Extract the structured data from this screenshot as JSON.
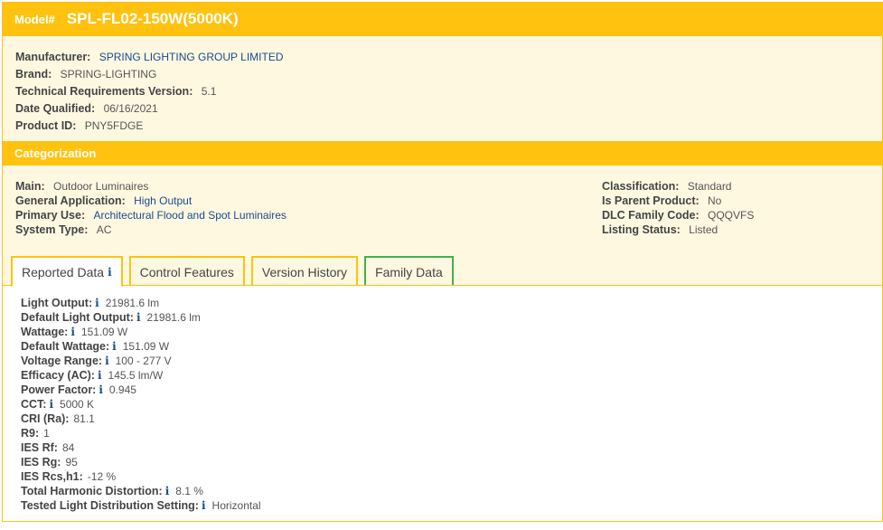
{
  "model": {
    "label": "Model#",
    "value": "SPL-FL02-150W(5000K)"
  },
  "info": [
    {
      "label": "Manufacturer:",
      "value": "SPRING LIGHTING GROUP LIMITED",
      "link": true
    },
    {
      "label": "Brand:",
      "value": "SPRING-LIGHTING",
      "link": false
    },
    {
      "label": "Technical Requirements Version:",
      "value": "5.1",
      "link": false
    },
    {
      "label": "Date Qualified:",
      "value": "06/16/2021",
      "link": false
    },
    {
      "label": "Product ID:",
      "value": "PNY5FDGE",
      "link": false
    }
  ],
  "categorization": {
    "title": "Categorization",
    "left": [
      {
        "label": "Main:",
        "value": "Outdoor Luminaires",
        "link": false
      },
      {
        "label": "General Application:",
        "value": "High Output",
        "link": true
      },
      {
        "label": "Primary Use:",
        "value": "Architectural Flood and Spot Luminaires",
        "link": true
      },
      {
        "label": "System Type:",
        "value": "AC",
        "link": false
      }
    ],
    "right": [
      {
        "label": "Classification:",
        "value": "Standard"
      },
      {
        "label": "Is Parent Product:",
        "value": "No"
      },
      {
        "label": "DLC Family Code:",
        "value": "QQQVFS"
      },
      {
        "label": "Listing Status:",
        "value": "Listed"
      }
    ]
  },
  "tabs": [
    {
      "label": "Reported Data",
      "active": true,
      "info": true
    },
    {
      "label": "Control Features",
      "active": false,
      "info": false
    },
    {
      "label": "Version History",
      "active": false,
      "info": false
    },
    {
      "label": "Family Data",
      "active": false,
      "info": false
    }
  ],
  "reported_data": [
    {
      "label": "Light Output:",
      "value": "21981.6 lm",
      "info": true
    },
    {
      "label": "Default Light Output:",
      "value": "21981.6 lm",
      "info": true
    },
    {
      "label": "Wattage:",
      "value": "151.09 W",
      "info": true
    },
    {
      "label": "Default Wattage:",
      "value": "151.09 W",
      "info": true
    },
    {
      "label": "Voltage Range:",
      "value": "100 - 277 V",
      "info": true
    },
    {
      "label": "Efficacy (AC):",
      "value": "145.5 lm/W",
      "info": true
    },
    {
      "label": "Power Factor:",
      "value": "0.945",
      "info": true
    },
    {
      "label": "CCT:",
      "value": "5000 K",
      "info": true
    },
    {
      "label": "CRI (Ra):",
      "value": "81.1",
      "info": false
    },
    {
      "label": "R9:",
      "value": "1",
      "info": false
    },
    {
      "label": "IES Rf:",
      "value": "84",
      "info": false
    },
    {
      "label": "IES Rg:",
      "value": "95",
      "info": false
    },
    {
      "label": "IES Rcs,h1:",
      "value": "-12 %",
      "info": false
    },
    {
      "label": "Total Harmonic Distortion:",
      "value": "8.1 %",
      "info": true
    },
    {
      "label": "Tested Light Distribution Setting:",
      "value": "Horizontal",
      "info": true
    }
  ],
  "info_icon": "i",
  "colors": {
    "accent": "#ffc20e",
    "panel": "#fff8e1",
    "link": "#1a4b8c",
    "family_tab": "#3cb44b"
  }
}
